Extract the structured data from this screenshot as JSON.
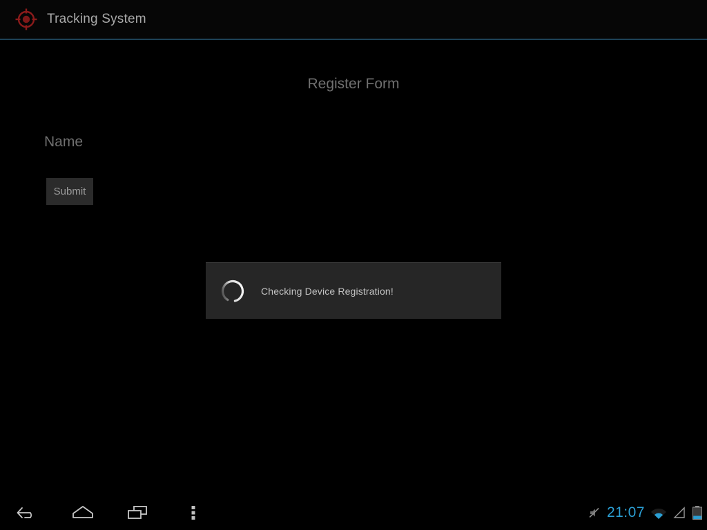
{
  "action_bar": {
    "app_icon": "target-crosshair-icon",
    "title": "Tracking System",
    "accent_divider_color": "#1d4257",
    "icon_color": "#8c1b1b"
  },
  "main": {
    "form_title": "Register Form",
    "name_input": {
      "placeholder": "Name",
      "value": ""
    },
    "submit_label": "Submit"
  },
  "dialog": {
    "spinner": "loading-spinner-icon",
    "message": "Checking Device Registration!"
  },
  "nav_bar": {
    "back": "back-icon",
    "home": "home-icon",
    "recents": "recent-apps-icon",
    "menu": "overflow-menu-icon"
  },
  "status_bar": {
    "mute": "volume-muted-icon",
    "clock": "21:07",
    "wifi": "wifi-icon",
    "signal": "cell-signal-icon",
    "battery": "battery-icon",
    "clock_color": "#2b9fd4"
  }
}
